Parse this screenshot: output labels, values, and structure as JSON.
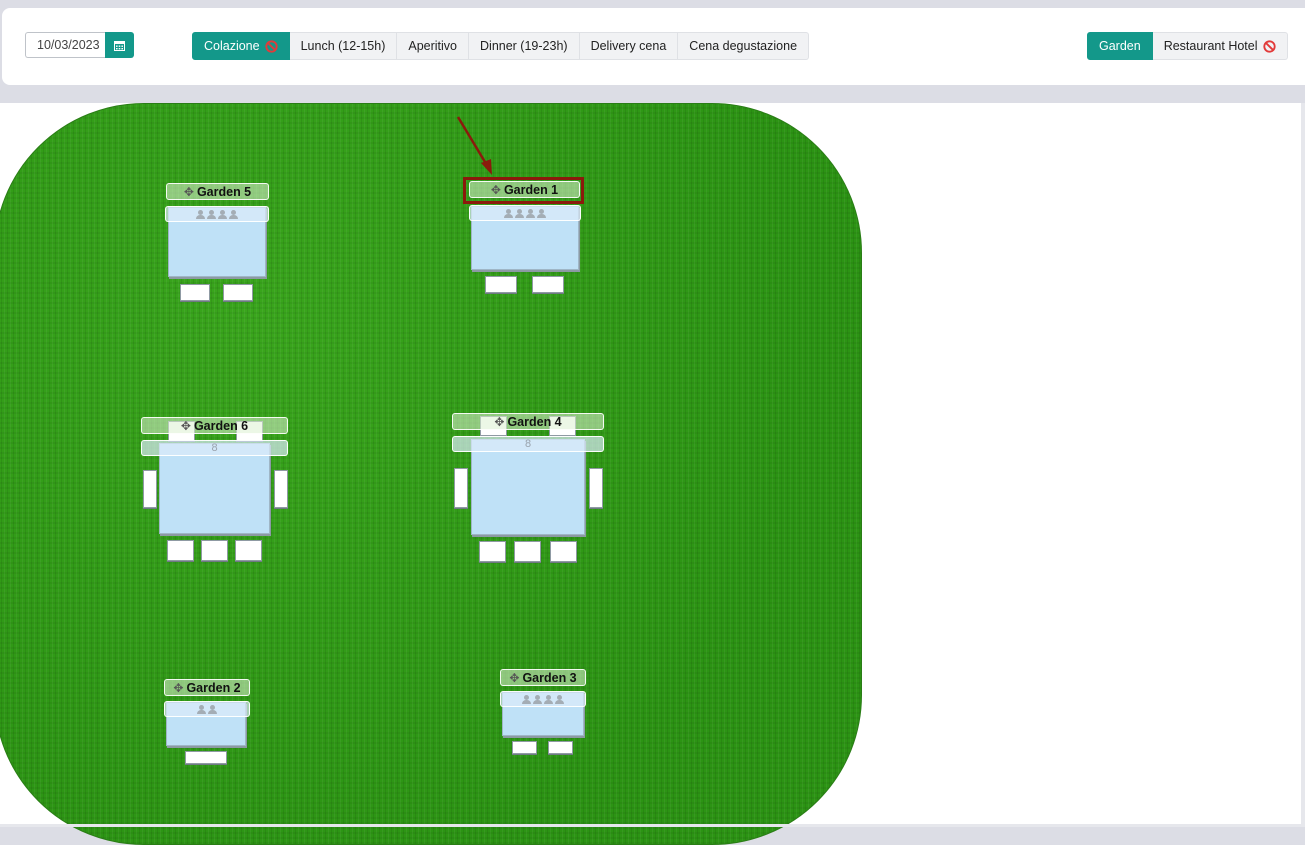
{
  "toolbar": {
    "date_value": "10/03/2023",
    "calendar_icon": "calendar-icon",
    "service_tabs": [
      {
        "label": "Colazione",
        "active": true,
        "blocked": true
      },
      {
        "label": "Lunch (12-15h)",
        "active": false,
        "blocked": false
      },
      {
        "label": "Aperitivo",
        "active": false,
        "blocked": false
      },
      {
        "label": "Dinner (19-23h)",
        "active": false,
        "blocked": false
      },
      {
        "label": "Delivery cena",
        "active": false,
        "blocked": false
      },
      {
        "label": "Cena degustazione",
        "active": false,
        "blocked": false
      }
    ],
    "room_tabs": [
      {
        "label": "Garden",
        "active": true,
        "blocked": false
      },
      {
        "label": "Restaurant Hotel",
        "active": false,
        "blocked": true
      }
    ]
  },
  "floor": {
    "tables": [
      {
        "name": "Garden 5",
        "covers_label": "",
        "people_icons": 4
      },
      {
        "name": "Garden 1",
        "covers_label": "",
        "people_icons": 4,
        "selected": true
      },
      {
        "name": "Garden 6",
        "covers_label": "8",
        "people_icons": 0
      },
      {
        "name": "Garden 4",
        "covers_label": "8",
        "people_icons": 0
      },
      {
        "name": "Garden 2",
        "covers_label": "",
        "people_icons": 2
      },
      {
        "name": "Garden 3",
        "covers_label": "",
        "people_icons": 4
      }
    ]
  },
  "colors": {
    "accent": "#13988a",
    "grass": "#2f9a16",
    "table": "#bfe1f7",
    "selection": "#8b1a0c"
  }
}
